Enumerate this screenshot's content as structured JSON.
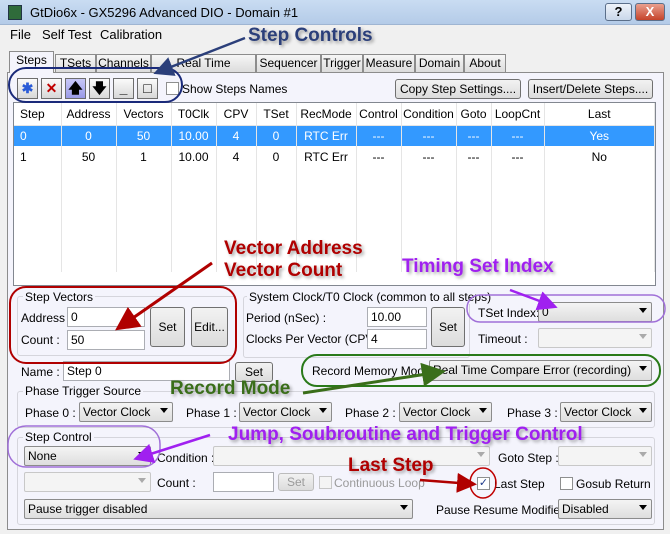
{
  "window": {
    "title": "GtDio6x - GX5296 Advanced DIO - Domain #1",
    "help_label": "?",
    "close_label": "X"
  },
  "menu": [
    "File",
    "Self Test",
    "Calibration"
  ],
  "tabs": [
    "Steps",
    "TSets",
    "Channels",
    "Real Time Compare",
    "Sequencer",
    "Trigger",
    "Measure",
    "Domain",
    "About"
  ],
  "toolbar": {
    "show_names_label": "Show Steps Names",
    "copy_label": "Copy Step Settings....",
    "insert_label": "Insert/Delete Steps...."
  },
  "table": {
    "headers": [
      "Step",
      "Address",
      "Vectors",
      "T0Clk",
      "CPV",
      "TSet",
      "RecMode",
      "Control",
      "Condition",
      "Goto",
      "LoopCnt",
      "Last"
    ],
    "rows": [
      [
        "0",
        "0",
        "50",
        "10.00",
        "4",
        "0",
        "RTC Err",
        "---",
        "---",
        "---",
        "---",
        "Yes"
      ],
      [
        "1",
        "50",
        "1",
        "10.00",
        "4",
        "0",
        "RTC Err",
        "---",
        "---",
        "---",
        "---",
        "No"
      ]
    ],
    "selected_row": 0
  },
  "step_vectors": {
    "title": "Step Vectors",
    "address_label": "Address :",
    "address": "0",
    "count_label": "Count :",
    "count": "50",
    "set_label": "Set",
    "edit_label": "Edit..."
  },
  "clock": {
    "title": "System Clock/T0 Clock (common to all steps)",
    "period_label": "Period (nSec) :",
    "period": "10.00",
    "cpv_label": "Clocks Per Vector (CPV):",
    "cpv": "4",
    "set_label": "Set"
  },
  "tset": {
    "index_label": "TSet Index:",
    "index": "0",
    "timeout_label": "Timeout :",
    "timeout": ""
  },
  "name": {
    "label": "Name :",
    "value": "Step 0",
    "set_label": "Set"
  },
  "record": {
    "label": "Record Memory Mode :",
    "value": "Real Time Compare Error (recording)"
  },
  "phase": {
    "title": "Phase Trigger Source",
    "items": [
      {
        "label": "Phase 0 :",
        "value": "Vector Clock"
      },
      {
        "label": "Phase 1 :",
        "value": "Vector Clock"
      },
      {
        "label": "Phase 2 :",
        "value": "Vector Clock"
      },
      {
        "label": "Phase 3 :",
        "value": "Vector Clock"
      }
    ]
  },
  "step_control": {
    "title": "Step Control",
    "value": "None",
    "condition_label": "Condition :",
    "goto_label": "Goto Step :",
    "count_label": "Count :",
    "count": "",
    "set_label": "Set",
    "continuous_label": "Continuous Loop",
    "last_step_label": "Last Step",
    "last_step_checked": true,
    "gosub_label": "Gosub Return",
    "pause_trigger": "Pause trigger disabled",
    "pause_modifier_label": "Pause Resume Modifier :",
    "pause_modifier": "Disabled"
  },
  "annotations": {
    "step_controls": "Step Controls",
    "vector_address": "Vector Address",
    "vector_count": "Vector Count",
    "timing_set": "Timing Set Index",
    "record_mode": "Record Mode",
    "jump": "Jump, Soubroutine and Trigger Control",
    "last_step": "Last Step"
  },
  "colors": {
    "selection": "#3399ff",
    "ann_navy": "#2b3f7a",
    "ann_red": "#b00000",
    "ann_purple": "#a020f0",
    "ann_green": "#3a6e1a"
  }
}
